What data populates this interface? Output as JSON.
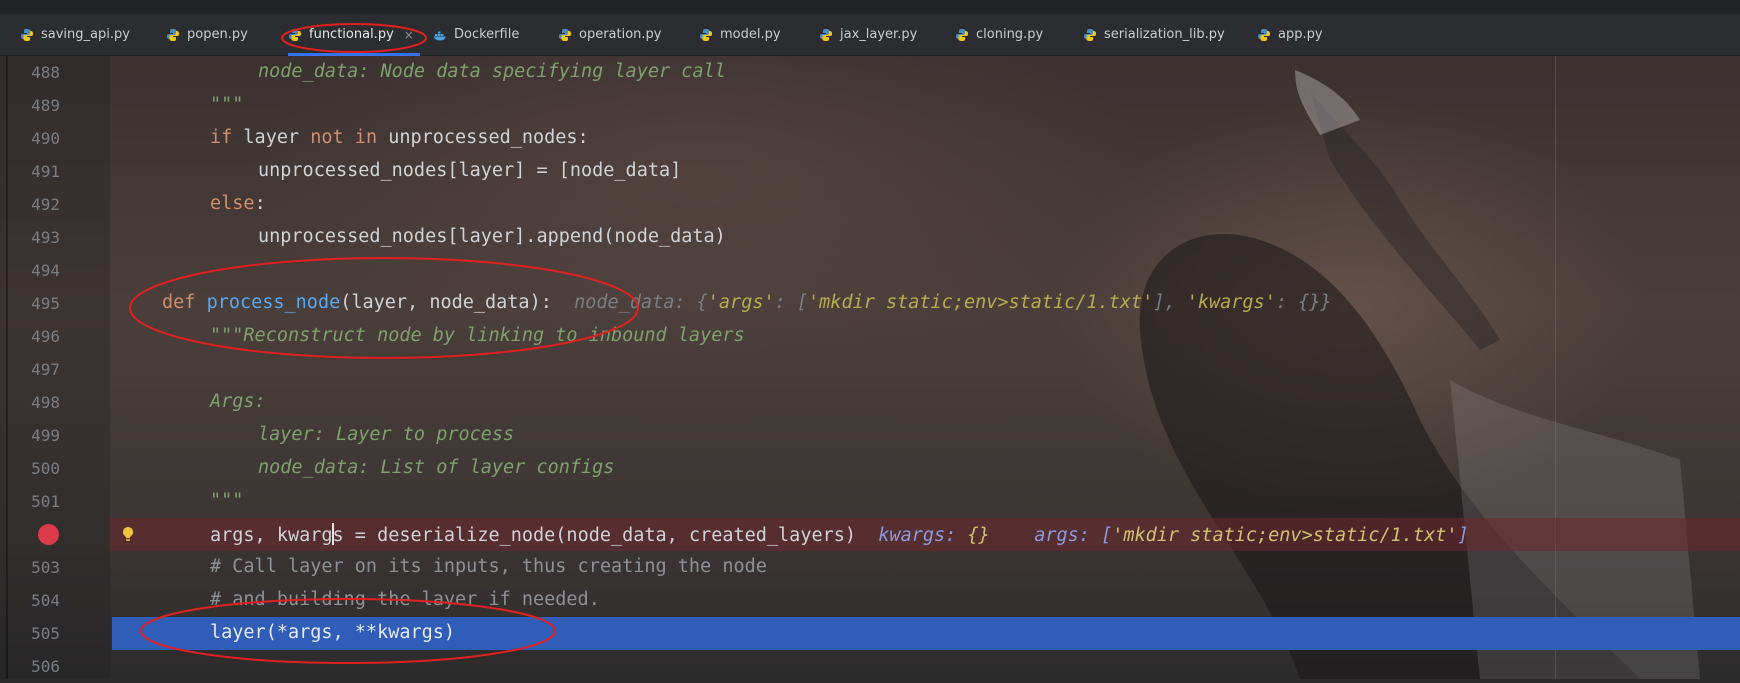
{
  "tabs": [
    {
      "label": "saving_api.py",
      "icon": "python-file-icon"
    },
    {
      "label": "popen.py",
      "icon": "python-file-icon"
    },
    {
      "label": "functional.py",
      "icon": "python-file-icon",
      "active": true,
      "close": "×"
    },
    {
      "label": "Dockerfile",
      "icon": "docker-icon"
    },
    {
      "label": "operation.py",
      "icon": "python-file-icon"
    },
    {
      "label": "model.py",
      "icon": "python-file-icon"
    },
    {
      "label": "jax_layer.py",
      "icon": "python-file-icon"
    },
    {
      "label": "cloning.py",
      "icon": "python-file-icon"
    },
    {
      "label": "serialization_lib.py",
      "icon": "python-file-icon"
    },
    {
      "label": "app.py",
      "icon": "python-file-icon"
    }
  ],
  "colors": {
    "accent": "#3574f0",
    "breakpoint": "#db3b4b",
    "execution_line": "#2f5db7",
    "annotation": "#e02020"
  },
  "editor": {
    "lines": {
      "l488": {
        "num": "488",
        "text": "node_data: Node data specifying layer call"
      },
      "l489": {
        "num": "489",
        "text": "\"\"\""
      },
      "l490": {
        "num": "490",
        "kw1": "if",
        "a": " layer ",
        "kw2": "not in",
        "b": " unprocessed_nodes:"
      },
      "l491": {
        "num": "491",
        "text": "unprocessed_nodes[layer] = [node_data]"
      },
      "l492": {
        "num": "492",
        "kw": "else",
        "rest": ":"
      },
      "l493": {
        "num": "493",
        "text": "unprocessed_nodes[layer].append(node_data)"
      },
      "l494": {
        "num": "494"
      },
      "l495": {
        "num": "495",
        "kw": "def",
        "fn": "process_node",
        "params": "(layer, node_data):",
        "hint_name": "node_data: {",
        "hint_k1": "'args'",
        "hint_c1": ": [",
        "hint_v1": "'mkdir static;env>static/1.txt'",
        "hint_c2": "], ",
        "hint_k2": "'kwargs'",
        "hint_c3": ": {}}"
      },
      "l496": {
        "num": "496",
        "text": "\"\"\"Reconstruct node by linking to inbound layers"
      },
      "l497": {
        "num": "497"
      },
      "l498": {
        "num": "498",
        "text": "Args:"
      },
      "l499": {
        "num": "499",
        "text": "layer: Layer to process"
      },
      "l500": {
        "num": "500",
        "text": "node_data: List of layer configs"
      },
      "l501": {
        "num": "501",
        "text": "\"\"\""
      },
      "l502": {
        "a": "args, kwarg",
        "b": "s = deserialize_node(node_data, created_layers)",
        "hint1_name": "kwargs: ",
        "hint1_val": "{}",
        "hint2_name": "args: [",
        "hint2_val": "'mkdir static;env>static/1.txt'",
        "hint2_end": "]"
      },
      "l503": {
        "num": "503",
        "text": "# Call layer on its inputs, thus creating the node"
      },
      "l504": {
        "num": "504",
        "text": "# and building the layer if needed."
      },
      "l505": {
        "num": "505",
        "text": "layer(*args, **kwargs)"
      },
      "l506": {
        "num": "506"
      }
    }
  }
}
